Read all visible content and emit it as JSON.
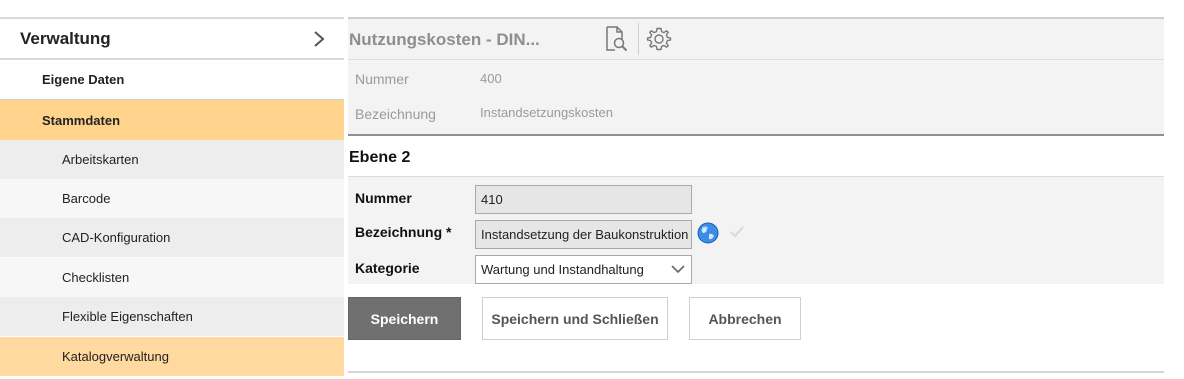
{
  "sidebar": {
    "title": "Verwaltung",
    "items": [
      {
        "label": "Eigene Daten"
      },
      {
        "label": "Stammdaten"
      },
      {
        "label": "Arbeitskarten"
      },
      {
        "label": "Barcode"
      },
      {
        "label": "CAD-Konfiguration"
      },
      {
        "label": "Checklisten"
      },
      {
        "label": "Flexible Eigenschaften"
      },
      {
        "label": "Katalogverwaltung"
      }
    ]
  },
  "header": {
    "title": "Nutzungskosten - DIN...",
    "icons": [
      "document-search-icon",
      "gear-icon"
    ]
  },
  "readonly": {
    "number_label": "Nummer",
    "number_value": "400",
    "name_label": "Bezeichnung",
    "name_value": "Instandsetzungskosten"
  },
  "section": {
    "title": "Ebene 2"
  },
  "form": {
    "number_label": "Nummer",
    "number_value": "410",
    "name_label": "Bezeichnung *",
    "name_value": "Instandsetzung der Baukonstruktion",
    "category_label": "Kategorie",
    "category_value": "Wartung und Instandhaltung"
  },
  "buttons": {
    "save": "Speichern",
    "save_close": "Speichern und Schließen",
    "cancel": "Abbrechen"
  },
  "colors": {
    "selected": "#ffd38c",
    "primary_button": "#707070"
  }
}
